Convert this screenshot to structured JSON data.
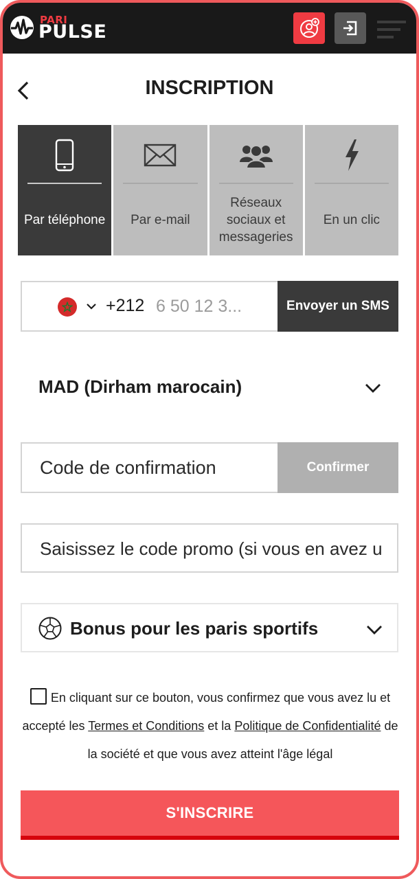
{
  "header": {
    "logo_top": "PARI",
    "logo_main": "PULSE",
    "register_icon": "user-add-icon",
    "login_icon": "login-icon",
    "menu_icon": "menu-icon"
  },
  "page": {
    "title": "INSCRIPTION",
    "back_icon": "chevron-left-icon"
  },
  "tabs": [
    {
      "label": "Par téléphone",
      "icon": "phone-icon",
      "active": true
    },
    {
      "label": "Par e-mail",
      "icon": "envelope-icon",
      "active": false
    },
    {
      "label": "Réseaux sociaux et messageries",
      "icon": "group-icon",
      "active": false
    },
    {
      "label": "En un clic",
      "icon": "lightning-icon",
      "active": false
    }
  ],
  "phone": {
    "country_flag": "morocco-flag-icon",
    "dial_code": "+212",
    "placeholder": "6 50 12 3...",
    "send_sms_label": "Envoyer un SMS"
  },
  "currency": {
    "value": "MAD (Dirham marocain)"
  },
  "confirmation": {
    "placeholder": "Code de confirmation",
    "button_label": "Confirmer"
  },
  "promo": {
    "placeholder": "Saisissez le code promo (si vous en avez un)"
  },
  "bonus": {
    "label": "Bonus pour les paris sportifs",
    "icon": "soccer-ball-icon"
  },
  "terms": {
    "text_1": "En cliquant sur ce bouton, vous confirmez que vous avez lu et accepté les ",
    "link_terms": "Termes et Conditions",
    "text_2": " et la ",
    "link_privacy": "Politique de Confidentialité",
    "text_3": " de la société et que vous avez atteint l'âge légal",
    "checked": false
  },
  "submit": {
    "label": "S'INSCRIRE"
  },
  "colors": {
    "accent": "#ef3b42",
    "submit_bg": "#f5565a",
    "submit_border": "#d6040c",
    "dark": "#3a3a3a",
    "frame": "#ef5a5c"
  }
}
